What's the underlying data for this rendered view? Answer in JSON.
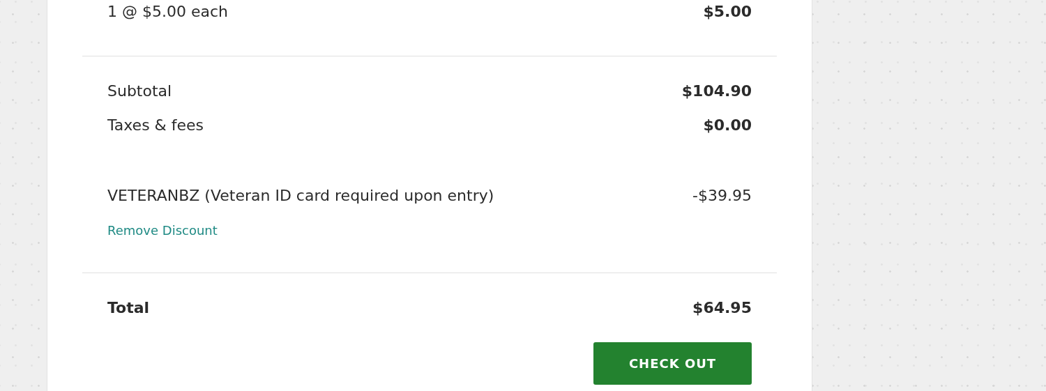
{
  "item": {
    "quantity_line": "1 @ $5.00 each",
    "amount": "$5.00"
  },
  "summary": [
    {
      "label": "Subtotal",
      "amount": "$104.90"
    },
    {
      "label": "Taxes & fees",
      "amount": "$0.00"
    }
  ],
  "discount": {
    "label": "VETERANBZ (Veteran ID card required upon entry)",
    "amount": "-$39.95",
    "remove_link": "Remove Discount"
  },
  "total": {
    "label": "Total",
    "amount": "$64.95"
  },
  "checkout_button": "CHECK OUT"
}
